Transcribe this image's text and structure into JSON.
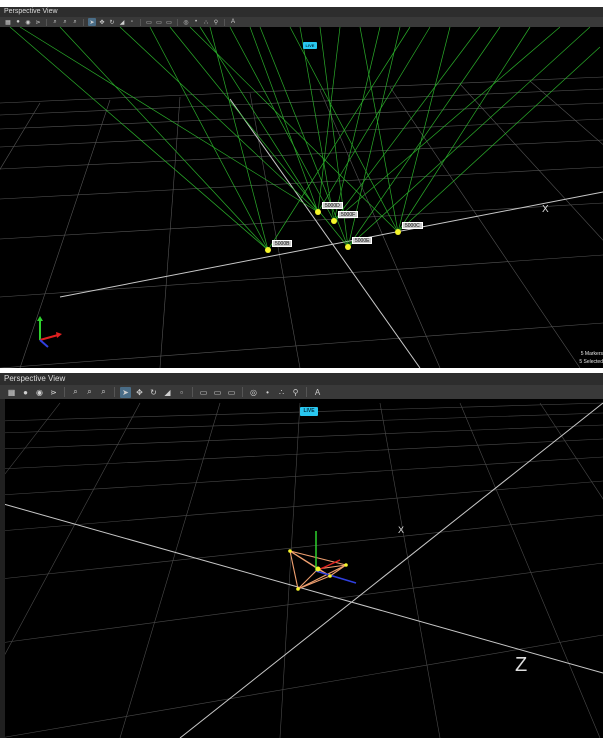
{
  "viewport_top": {
    "title": "Perspective View",
    "live_badge": "LIVE",
    "markers": [
      {
        "id": "marker-5000B",
        "label": "5000B"
      },
      {
        "id": "marker-5000D",
        "label": "5000D"
      },
      {
        "id": "marker-5000F",
        "label": "5000F"
      },
      {
        "id": "marker-5000E",
        "label": "5000E"
      },
      {
        "id": "marker-5000C",
        "label": "5000C"
      }
    ],
    "status_markers": "5 Markers",
    "status_selected": "5 Selected",
    "grid_axis_label": "X"
  },
  "viewport_bottom": {
    "title": "Perspective View",
    "live_badge": "LIVE",
    "grid_axis_label_near": "Z",
    "grid_axis_label_far": "X"
  },
  "toolbar": {
    "icons": [
      "grid-icon",
      "camera-icon",
      "screenshot-icon",
      "node-icon",
      "zoom-icon",
      "zoom-in-icon",
      "zoom-fit-icon",
      "select-icon",
      "move-icon",
      "rotate-icon",
      "scale-icon",
      "local-icon",
      "view-front-icon",
      "view-top-icon",
      "view-side-icon",
      "visibility-icon",
      "markers-icon",
      "rigid-icon",
      "skeleton-icon",
      "text-icon"
    ]
  },
  "colors": {
    "background": "#000000",
    "grid": "#6a6a6a",
    "ray": "#2fbf2f",
    "marker": "#f5f52a",
    "live": "#29c7f0",
    "rigidbody": "#f0a070"
  }
}
